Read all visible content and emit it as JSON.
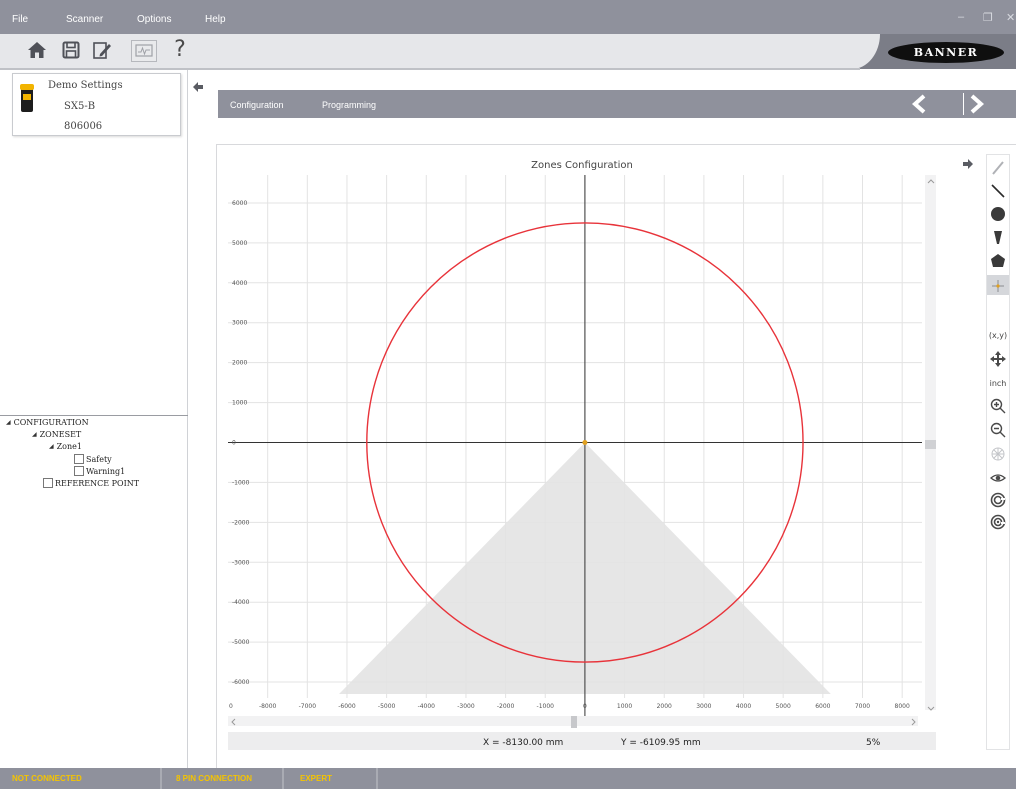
{
  "menu": {
    "items": [
      "File",
      "Scanner",
      "Options",
      "Help"
    ],
    "minimize": "–",
    "restore": "❐",
    "close": "✕"
  },
  "toolbar": {
    "buttons": [
      "home-icon",
      "save-icon",
      "edit-document-icon",
      "monitor-icon",
      "help-icon"
    ],
    "help_label": "?",
    "brand": "BANNER"
  },
  "device": {
    "name": "Demo Settings",
    "model": "SX5-B",
    "serial": "806006"
  },
  "tree": {
    "configuration": "CONFIGURATION",
    "zoneset": "ZONESET",
    "zone": "Zone1",
    "safety": "Safety",
    "warning": "Warning1",
    "reference": "REFERENCE POINT"
  },
  "tabs": [
    "Configuration",
    "Programming"
  ],
  "chart_data": {
    "type": "scatter",
    "title": "Zones Configuration",
    "xlim": [
      -9000,
      8500
    ],
    "ylim": [
      -6700,
      6700
    ],
    "x_ticks": [
      -8000,
      -7000,
      -6000,
      -5000,
      -4000,
      -3000,
      -2000,
      -1000,
      0,
      1000,
      2000,
      3000,
      4000,
      5000,
      6000,
      7000,
      8000
    ],
    "x_first_label": "0",
    "y_ticks": [
      6000,
      5000,
      4000,
      3000,
      2000,
      1000,
      0,
      -1000,
      -2000,
      -3000,
      -4000,
      -5000,
      -6000
    ],
    "grid": true,
    "zones": [
      {
        "name": "circle",
        "shape": "circle",
        "center": [
          0,
          0
        ],
        "radius": 5500,
        "color": "#e8333a"
      },
      {
        "name": "field-of-view",
        "shape": "triangle",
        "vertices": [
          [
            0,
            0
          ],
          [
            -6200,
            -6300
          ],
          [
            6200,
            -6300
          ]
        ],
        "color": "#e6e6e6"
      }
    ],
    "origin_marker": {
      "x": 0,
      "y": 0,
      "color": "#e0a020"
    }
  },
  "coords": {
    "x": "X = -8130.00 mm",
    "y": "Y = -6109.95 mm",
    "zoom": "5%"
  },
  "tools": {
    "items": [
      "pencil-icon",
      "line-icon",
      "circle-icon",
      "sector-icon",
      "polygon-icon",
      "reference-point-icon",
      "xy-label",
      "move-icon",
      "unit-label",
      "zoom-in-icon",
      "zoom-out-icon",
      "grid-icon",
      "eye-icon",
      "rotate-cw-icon",
      "rotate-ccw-icon"
    ],
    "xy_label": "(x,y)",
    "unit_label": "inch"
  },
  "status": {
    "connection": "NOT CONNECTED",
    "pin": "8 PIN CONNECTION",
    "mode": "EXPERT"
  },
  "colors": {
    "bar": "#8f919c",
    "status_text": "#f5c400",
    "zone_red": "#e8333a"
  }
}
